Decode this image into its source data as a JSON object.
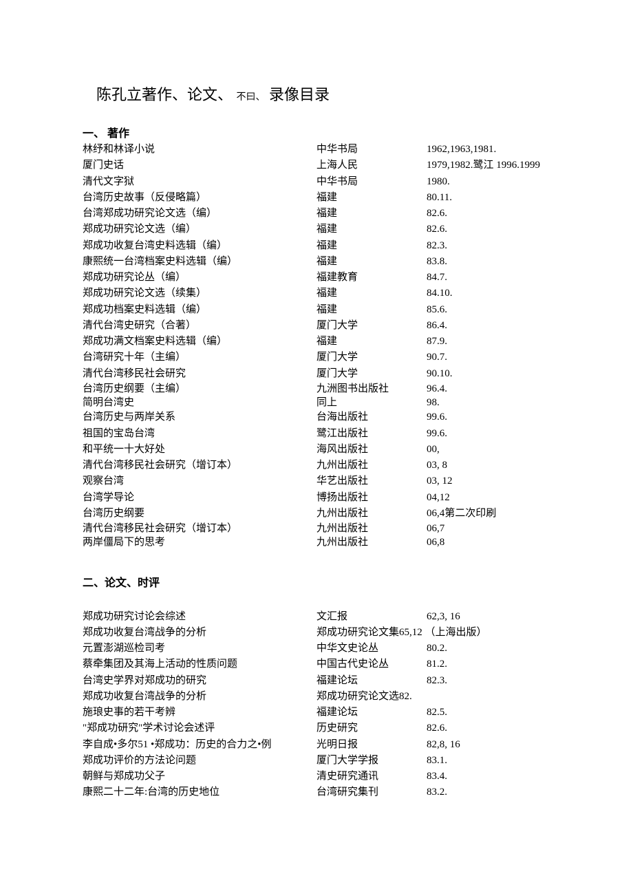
{
  "title_main": "陈孔立著作、论文、",
  "title_small": "不曰、",
  "title_end": "录像目录",
  "section1": "一、  著作",
  "section2": "二、论文、时评",
  "works": [
    {
      "t": "林纾和林译小说",
      "p": "中华书局",
      "d": "1962,1963,1981."
    },
    {
      "t": "厦门史话",
      "p": "上海人民",
      "d": "   1979,1982.鹭江 1996.1999"
    },
    {
      "t": "清代文字狱",
      "p": "中华书局",
      "d": "   1980."
    },
    {
      "t": "台湾历史故事（反侵略篇）",
      "p": "福建",
      "d": "80.11."
    },
    {
      "t": "台湾郑成功研究论文选（编）",
      "p": "福建",
      "d": "82.6."
    },
    {
      "t": "郑成功研究论文选（编）",
      "p": "福建",
      "d": "82.6."
    },
    {
      "t": "郑成功收复台湾史料选辑（编）",
      "p": "福建",
      "d": "82.3."
    },
    {
      "t": "康熙统一台湾档案史料选辑（编）",
      "p": "福建",
      "d": "83.8."
    },
    {
      "t": "郑成功研究论丛（编）",
      "p": "福建教育",
      "d": "84.7."
    },
    {
      "t": "郑成功研究论文选（续集）",
      "p": "福建",
      "d": "84.10."
    },
    {
      "t": "郑成功档案史料选辑（编）",
      "p": "福建",
      "d": "85.6."
    },
    {
      "t": "清代台湾史研究（合著）",
      "p": "厦门大学",
      "d": "86.4."
    },
    {
      "t": "郑成功满文档案史料选辑（编）",
      "p": "福建",
      "d": "87.9."
    },
    {
      "t": "台湾研究十年（主编）",
      "p": "厦门大学",
      "d": "90.7."
    },
    {
      "t": "清代台湾移民社会研究",
      "p": "厦门大学",
      "d": "90.10."
    },
    {
      "t": "台湾历史纲要（主编）",
      "p": "九洲图书出版社",
      "d": "96.4.",
      "tight": true
    },
    {
      "t": "简明台湾史",
      "p": "同上",
      "d": "98.",
      "tight": true
    },
    {
      "t": "台湾历史与两岸关系",
      "p": "台海出版社",
      "d": "99.6."
    },
    {
      "t": "祖国的宝岛台湾",
      "p": "鹭江出版社",
      "d": "99.6."
    },
    {
      "t": "和平统一十大好处",
      "p": "海风出版社",
      "d": "00,"
    },
    {
      "t": "清代台湾移民社会研究（增订本）",
      "p": "九州出版社",
      "d": "03, 8"
    },
    {
      "t": "观察台湾",
      "p": "华艺出版社",
      "d": "03, 12"
    },
    {
      "t": "台湾学导论",
      "p": "博扬出版社",
      "d": "04,12"
    },
    {
      "t": "台湾历史纲要",
      "p": "九州出版社",
      "d": "06,4第二次印刷"
    },
    {
      "t": "清代台湾移民社会研究（增订本）",
      "p": "九州出版社",
      "d": "06,7",
      "tight": true
    },
    {
      "t": "两岸僵局下的思考",
      "p": "九州出版社",
      "d": "06,8",
      "tight": true
    }
  ],
  "papers": [
    {
      "t": "郑成功研究讨论会综述",
      "p": "文汇报",
      "d": "62,3, 16"
    },
    {
      "t": "郑成功收复台湾战争的分析",
      "p": "郑成功研究论文集65,12 （上海出版）",
      "d": "",
      "wide": true
    },
    {
      "t": "元置澎湖巡检司考",
      "p": "中华文史论丛",
      "d": "80.2."
    },
    {
      "t": "蔡牵集团及其海上活动的性质问题",
      "p": "中国古代史论丛",
      "d": "81.2."
    },
    {
      "t": "台湾史学界对郑成功的研究",
      "p": "福建论坛",
      "d": "82.3."
    },
    {
      "t": "郑成功收复台湾战争的分析",
      "p": "郑成功研究论文选82.",
      "d": "",
      "wide": true
    },
    {
      "t": "施琅史事的若干考辨",
      "p": "福建论坛",
      "d": "82.5."
    },
    {
      "t": "\"郑成功研究\"学术讨论会述评",
      "p": "历史研究",
      "d": "82.6."
    },
    {
      "t": "李自成•多尔51 •郑成功：历史的合力之•例",
      "p": "光明日报",
      "d": "82,8, 16"
    },
    {
      "t": "郑成功评价的方法论问题",
      "p": "厦门大学学报",
      "d": "83.1."
    },
    {
      "t": "朝鲜与郑成功父子",
      "p": "清史研究通讯",
      "d": "83.4."
    },
    {
      "t": "康熙二十二年:台湾的历史地位",
      "p": "台湾研究集刊",
      "d": "83.2."
    }
  ]
}
